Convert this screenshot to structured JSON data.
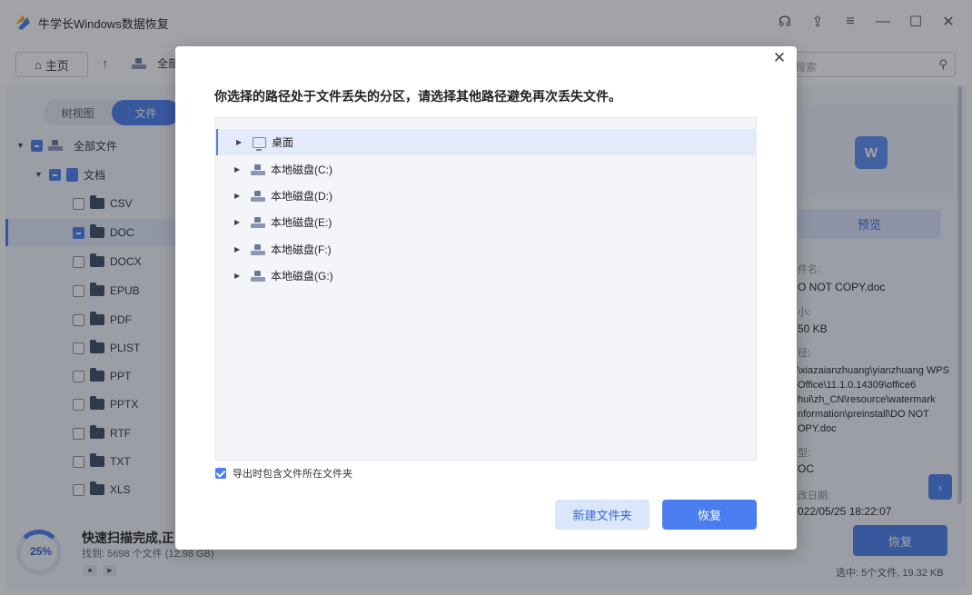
{
  "app": {
    "title": "牛学长Windows数据恢复",
    "accent": "#4a7ef0"
  },
  "toolbar": {
    "home_label": "主页",
    "breadcrumb": "全部",
    "search_placeholder": "搜索"
  },
  "view_switch": {
    "tree_label": "树视图",
    "file_label": "文件"
  },
  "tree": {
    "root": "全部文件",
    "docs": "文档",
    "types": [
      "CSV",
      "DOC",
      "DOCX",
      "EPUB",
      "PDF",
      "PLIST",
      "PPT",
      "PPTX",
      "RTF",
      "TXT",
      "XLS"
    ],
    "selected": "DOC"
  },
  "status": {
    "progress": "25%",
    "title": "快速扫描完成,正",
    "found": "找到: 5698 个文件 (12.98 GB)"
  },
  "details": {
    "preview_label": "预览",
    "name_label": "件名:",
    "name_value": "O NOT COPY.doc",
    "size_label": "小:",
    "size_value": "50 KB",
    "path_label": "径:",
    "path_value": "\\xiazaianzhuang\\yianzhuang WPS Office\\11.1.0.14309\\office6 hui\\zh_CN\\resource\\watermark nformation\\preinstall\\DO NOT OPY.doc",
    "type_label": "型:",
    "type_value": "OC",
    "date_label": "改日期:",
    "date_value": "022/05/25 18:22:07",
    "recover_label": "恢复",
    "selected_info": "选中: 5个文件, 19.32 KB"
  },
  "modal": {
    "title": "你选择的路径处于文件丢失的分区，请选择其他路径避免再次丢失文件。",
    "folders": [
      {
        "label": "桌面",
        "icon": "desktop-icon"
      },
      {
        "label": "本地磁盘(C:)",
        "icon": "drive-icon"
      },
      {
        "label": "本地磁盘(D:)",
        "icon": "drive-icon"
      },
      {
        "label": "本地磁盘(E:)",
        "icon": "drive-icon"
      },
      {
        "label": "本地磁盘(F:)",
        "icon": "drive-icon"
      },
      {
        "label": "本地磁盘(G:)",
        "icon": "drive-icon"
      }
    ],
    "selected_folder": "桌面",
    "include_folder_label": "导出时包含文件所在文件夹",
    "include_folder_checked": true,
    "new_folder_label": "新建文件夹",
    "recover_label": "恢复"
  }
}
